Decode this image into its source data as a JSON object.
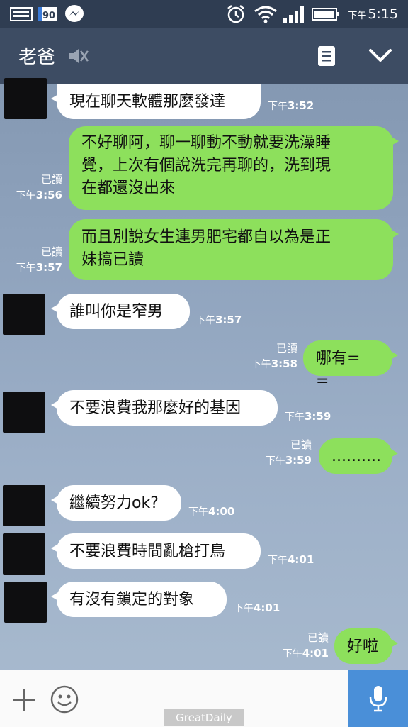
{
  "status_bar": {
    "badge": "90",
    "time_prefix": "下午",
    "time": "5:15"
  },
  "header": {
    "title": "老爸"
  },
  "messages": [
    {
      "text": "現在聊天軟體那麼發達",
      "ampm": "下午",
      "time": "3:52"
    },
    {
      "line1": "不好聊阿，聊一聊動不動就要洗澡睡",
      "line2": "覺，上次有個說洗完再聊的，洗到現",
      "line3": "在都還沒出來",
      "read": "已讀",
      "ampm": "下午",
      "time": "3:56"
    },
    {
      "line1": "而且別說女生連男肥宅都自以為是正",
      "line2": "妹搞已讀",
      "read": "已讀",
      "ampm": "下午",
      "time": "3:57"
    },
    {
      "text": "誰叫你是窄男",
      "ampm": "下午",
      "time": "3:57"
    },
    {
      "text": "哪有=　=",
      "read": "已讀",
      "ampm": "下午",
      "time": "3:58"
    },
    {
      "text": "不要浪費我那麼好的基因",
      "ampm": "下午",
      "time": "3:59"
    },
    {
      "text": "..........",
      "read": "已讀",
      "ampm": "下午",
      "time": "3:59"
    },
    {
      "text": "繼續努力ok?",
      "ampm": "下午",
      "time": "4:00"
    },
    {
      "text": "不要浪費時間亂槍打鳥",
      "ampm": "下午",
      "time": "4:01"
    },
    {
      "text": "有沒有鎖定的對象",
      "ampm": "下午",
      "time": "4:01"
    },
    {
      "text": "好啦",
      "read": "已讀",
      "ampm": "下午",
      "time": "4:01"
    }
  ],
  "footer": {
    "watermark": "GreatDaily"
  },
  "icons": {
    "mute": "mute-icon",
    "menu": "menu-icon",
    "collapse": "chevron-down-icon",
    "add": "plus-icon",
    "emoji": "emoji-icon",
    "mic": "mic-icon"
  },
  "colors": {
    "outgoing_bubble": "#8de05c",
    "incoming_bubble": "#ffffff",
    "header": "#3d4c63",
    "status_bar": "#2f3d52",
    "mic_button": "#4a8fd8"
  }
}
